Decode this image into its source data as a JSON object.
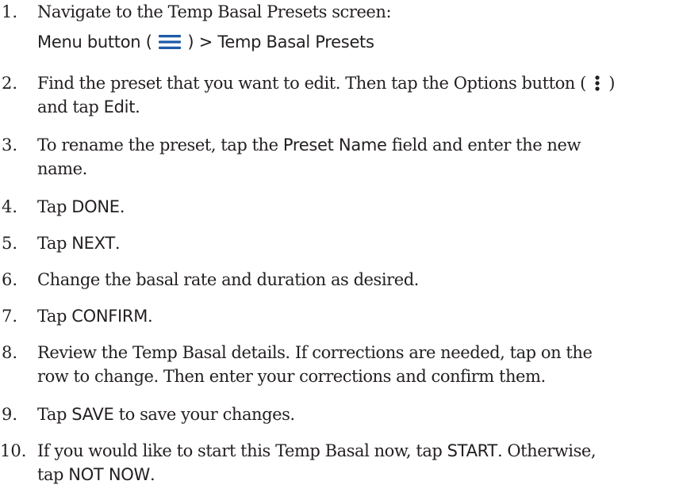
{
  "steps": [
    {
      "number": "1.",
      "text_before": "Navigate to the Temp Basal Presets screen:",
      "path": {
        "menu_button": "Menu button",
        "open_paren": "(",
        "close_paren": ")",
        "separator": ">",
        "target": "Temp Basal Presets"
      },
      "icon": "menu-icon"
    },
    {
      "number": "2.",
      "line1": "Find the preset that you want to edit. Then tap the Options button (",
      "line1_end": ")",
      "line2_a": "and tap",
      "line2_ui": "Edit",
      "line2_end": ".",
      "icon": "options-dots-icon"
    },
    {
      "number": "3.",
      "line1_a": "To rename the preset, tap the",
      "line1_ui": "Preset Name",
      "line1_b": "field and enter the new",
      "line2": "name."
    },
    {
      "number": "4.",
      "a": "Tap",
      "ui": "DONE",
      "b": "."
    },
    {
      "number": "5.",
      "a": "Tap",
      "ui": "NEXT",
      "b": "."
    },
    {
      "number": "6.",
      "text": "Change the basal rate and duration as desired."
    },
    {
      "number": "7.",
      "a": "Tap",
      "ui": "CONFIRM",
      "b": "."
    },
    {
      "number": "8.",
      "line1": "Review the Temp Basal details. If corrections are needed, tap on the",
      "line2": "row to change. Then enter your corrections and confirm them."
    },
    {
      "number": "9.",
      "a": "Tap",
      "ui": "SAVE",
      "b": "to save your changes."
    },
    {
      "number": "10.",
      "line1_a": "If you would like to start this Temp Basal now, tap",
      "line1_ui": "START",
      "line1_b": ". Otherwise,",
      "line2_a": "tap",
      "line2_ui": "NOT NOW",
      "line2_b": "."
    }
  ],
  "colors": {
    "text": "#231f20",
    "icon_accent": "#1e5aa8"
  }
}
